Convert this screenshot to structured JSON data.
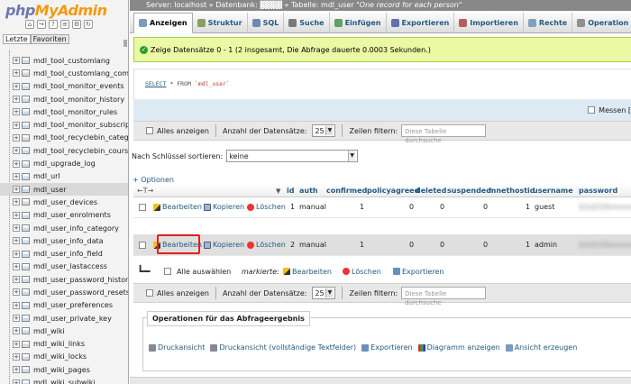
{
  "logo": {
    "part1": "php",
    "part2": "MyAdmin"
  },
  "nav_tabs": [
    "Letzte",
    "Favoriten"
  ],
  "tree": [
    "mdl_tool_customlang",
    "mdl_tool_customlang_com",
    "mdl_tool_monitor_events",
    "mdl_tool_monitor_history",
    "mdl_tool_monitor_rules",
    "mdl_tool_monitor_subscrip",
    "mdl_tool_recyclebin_categ",
    "mdl_tool_recyclebin_cours",
    "mdl_upgrade_log",
    "mdl_url",
    "mdl_user",
    "mdl_user_devices",
    "mdl_user_enrolments",
    "mdl_user_info_category",
    "mdl_user_info_data",
    "mdl_user_info_field",
    "mdl_user_lastaccess",
    "mdl_user_password_histor",
    "mdl_user_password_resets",
    "mdl_user_preferences",
    "mdl_user_private_key",
    "mdl_wiki",
    "mdl_wiki_links",
    "mdl_wiki_locks",
    "mdl_wiki_pages",
    "mdl_wiki_subwiki"
  ],
  "active_table": "mdl_user",
  "breadcrumb": {
    "server": "Server: localhost",
    "db": "Datenbank:",
    "table": "Tabelle: mdl_user",
    "comment": "\"One record for each person\""
  },
  "tabs": [
    {
      "label": "Anzeigen",
      "color": "#7a9ac0"
    },
    {
      "label": "Struktur",
      "color": "#8aa060"
    },
    {
      "label": "SQL",
      "color": "#6a8ab0"
    },
    {
      "label": "Suche",
      "color": "#7a7a7a"
    },
    {
      "label": "Einfügen",
      "color": "#60a060"
    },
    {
      "label": "Exportieren",
      "color": "#6070b0"
    },
    {
      "label": "Importieren",
      "color": "#b06060"
    },
    {
      "label": "Rechte",
      "color": "#80a0c0"
    },
    {
      "label": "Operation",
      "color": "#909090"
    }
  ],
  "success_msg": "Zeige Datensätze 0 - 1 (2 insgesamt, Die Abfrage dauerte 0.0003 Sekunden.)",
  "sql": {
    "select": "SELECT",
    "rest": " * FROM ",
    "table": "`mdl_user`"
  },
  "profiling_label": "Messen [",
  "nav": {
    "show_all": "Alles anzeigen",
    "rows_label": "Anzahl der Datensätze:",
    "rows_value": "25",
    "filter_label": "Zeilen filtern:",
    "filter_placeholder": "Diese Tabelle durchsuche"
  },
  "sort": {
    "label": "Nach Schlüssel sortieren:",
    "value": "keine"
  },
  "options_link": "+ Optionen",
  "arrows": "←T→",
  "columns": [
    "id",
    "auth",
    "confirmed",
    "policyagreed",
    "deleted",
    "suspended",
    "mnethostid",
    "username",
    "password"
  ],
  "actions": {
    "edit": "Bearbeiten",
    "copy": "Kopieren",
    "delete": "Löschen"
  },
  "rows": [
    {
      "id": "1",
      "auth": "manual",
      "confirmed": "1",
      "policyagreed": "0",
      "deleted": "0",
      "suspended": "0",
      "mnethostid": "1",
      "username": "guest",
      "password": "$2y$10$xxxxxxxxxxxx"
    },
    {
      "id": "2",
      "auth": "manual",
      "confirmed": "1",
      "policyagreed": "0",
      "deleted": "0",
      "suspended": "0",
      "mnethostid": "1",
      "username": "admin",
      "password": "$2y$10$xxxxxxxxxxxx"
    }
  ],
  "bulk": {
    "select_all": "Alle auswählen",
    "marked": "markierte:",
    "edit": "Bearbeiten",
    "delete": "Löschen",
    "export": "Exportieren"
  },
  "ops": {
    "title": "Operationen für das Abfrageergebnis",
    "links": [
      "Druckansicht",
      "Druckansicht (vollständige Textfelder)",
      "Exportieren",
      "Diagramm anzeigen",
      "Ansicht erzeugen"
    ]
  }
}
